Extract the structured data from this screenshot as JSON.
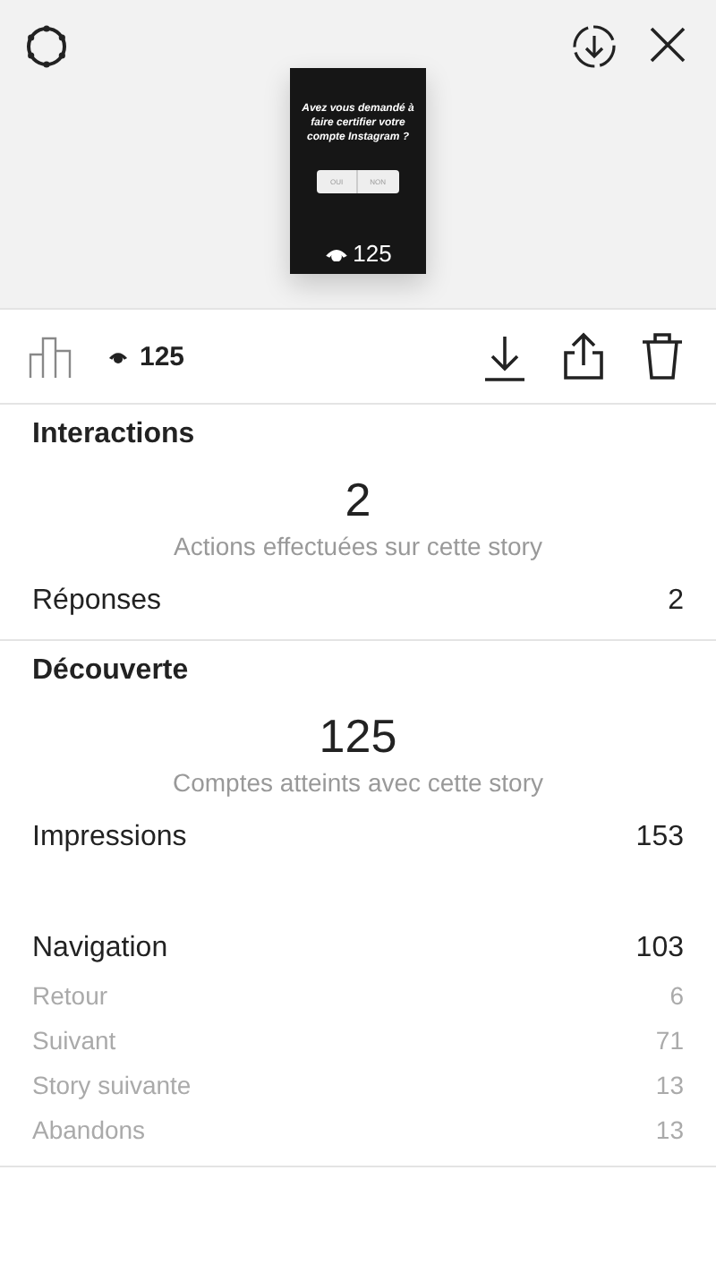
{
  "story": {
    "question": "Avez vous demandé à faire certifier votre compte Instagram ?",
    "options": [
      "OUI",
      "NON"
    ],
    "views": "125"
  },
  "toolbar": {
    "views": "125"
  },
  "sections": [
    {
      "title": "Interactions",
      "big_number": "2",
      "caption": "Actions effectuées sur cette story",
      "rows": [
        {
          "kind": "main",
          "label": "Réponses",
          "value": "2"
        }
      ]
    },
    {
      "title": "Découverte",
      "big_number": "125",
      "caption": "Comptes atteints avec cette story",
      "rows": [
        {
          "kind": "main",
          "label": "Impressions",
          "value": "153"
        },
        {
          "kind": "spacer"
        },
        {
          "kind": "main",
          "label": "Navigation",
          "value": "103"
        },
        {
          "kind": "sub",
          "label": "Retour",
          "value": "6"
        },
        {
          "kind": "sub",
          "label": "Suivant",
          "value": "71"
        },
        {
          "kind": "sub",
          "label": "Story suivante",
          "value": "13"
        },
        {
          "kind": "sub",
          "label": "Abandons",
          "value": "13"
        }
      ]
    }
  ]
}
